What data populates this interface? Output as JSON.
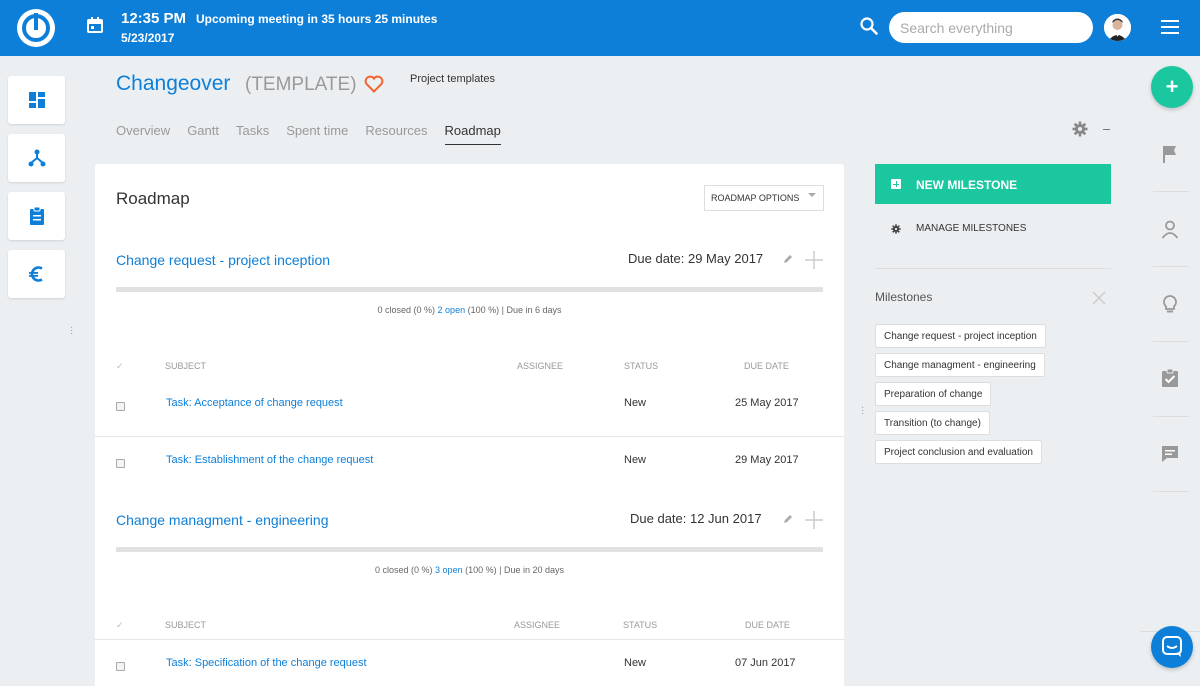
{
  "topbar": {
    "time": "12:35 PM",
    "meeting": "Upcoming meeting in 35 hours 25 minutes",
    "date": "5/23/2017",
    "search_placeholder": "Search everything",
    "icons": [
      "easy-logo",
      "calendar-icon",
      "search-icon",
      "user-avatar",
      "hamburger-menu-icon"
    ]
  },
  "left_sidebar": {
    "icons": [
      "dashboard-icon",
      "network-icon",
      "clipboard-icon",
      "euro-icon"
    ]
  },
  "project": {
    "title": "Changeover",
    "tag": "(TEMPLATE)",
    "breadcrumb": "Project templates",
    "tabs": [
      {
        "label": "Overview"
      },
      {
        "label": "Gantt"
      },
      {
        "label": "Tasks"
      },
      {
        "label": "Spent time"
      },
      {
        "label": "Resources"
      },
      {
        "label": "Roadmap",
        "active": true
      }
    ]
  },
  "roadmap": {
    "title": "Roadmap",
    "options_label": "ROADMAP OPTIONS",
    "columns": [
      "SUBJECT",
      "ASSIGNEE",
      "STATUS",
      "DUE DATE"
    ],
    "milestones": [
      {
        "title": "Change request - project inception",
        "due": "Due date: 29 May 2017",
        "stats_closed": "0 closed (0 %)",
        "stats_open": "2 open",
        "stats_rest": "(100 %) | Due in 6 days",
        "tasks": [
          {
            "subject": "Task: Acceptance of change request",
            "status": "New",
            "due": "25 May 2017"
          },
          {
            "subject": "Task: Establishment of the change request",
            "status": "New",
            "due": "29 May 2017"
          }
        ]
      },
      {
        "title": "Change managment - engineering",
        "due": "Due date: 12 Jun 2017",
        "stats_closed": "0 closed (0 %)",
        "stats_open": "3 open",
        "stats_rest": "(100 %) | Due in 20 days",
        "tasks": [
          {
            "subject": "Task: Specification of the change request",
            "status": "New",
            "due": "07 Jun 2017"
          }
        ]
      }
    ]
  },
  "right_panel": {
    "new_milestone": "NEW MILESTONE",
    "manage_milestones": "MANAGE MILESTONES",
    "milestones_label": "Milestones",
    "milestone_tags": [
      "Change request - project inception",
      "Change managment - engineering",
      "Preparation of change",
      "Transition (to change)",
      "Project conclusion and evaluation"
    ]
  },
  "right_rail": {
    "fab": "+",
    "icons": [
      "flag-icon",
      "person-icon",
      "lightbulb-icon",
      "checklist-icon",
      "comment-icon",
      "chat-bubble-icon"
    ]
  },
  "colors": {
    "brand_blue": "#0d7fd8",
    "accent_green": "#1ac79f",
    "heart_orange": "#f26430"
  }
}
